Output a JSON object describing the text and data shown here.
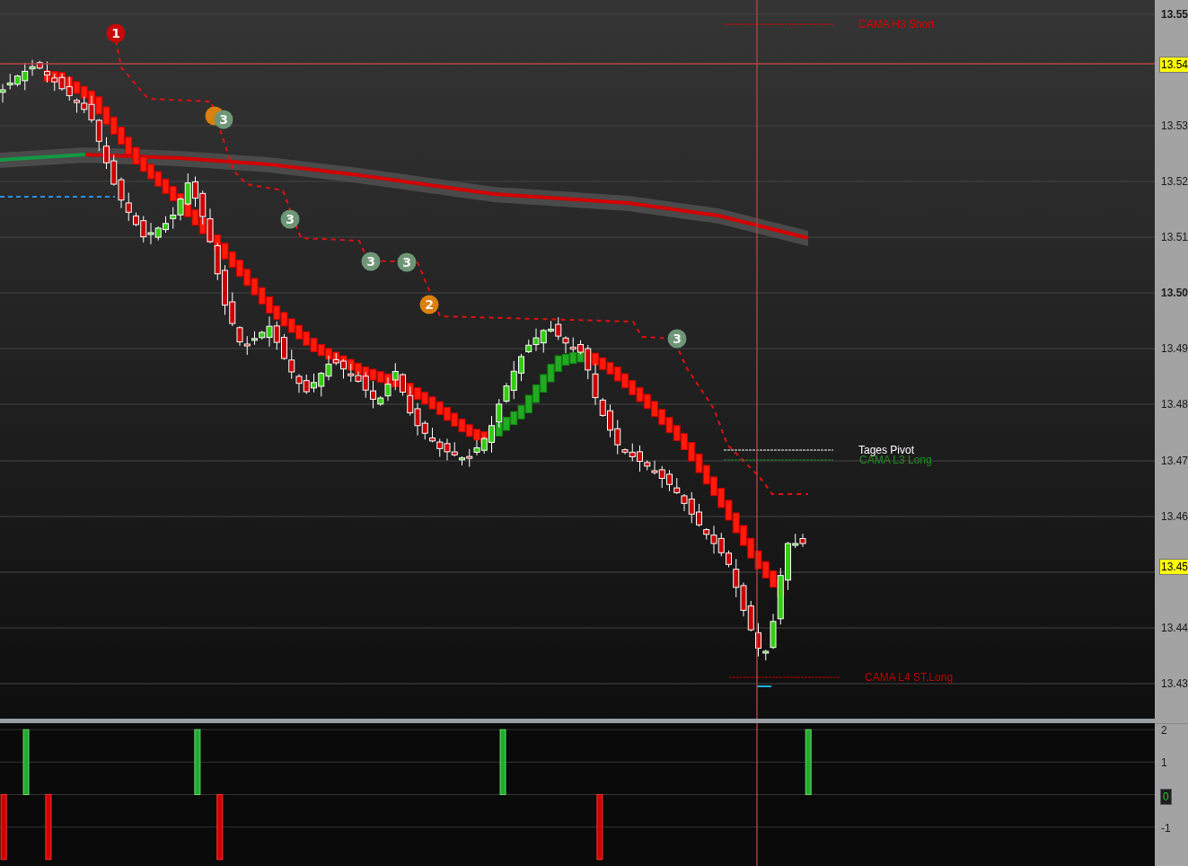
{
  "price_chart": {
    "signals": [
      {
        "label": "1",
        "color": "#c80a0a"
      },
      {
        "label": "3",
        "color": "#6e9676"
      },
      {
        "label": "3",
        "color": "#6e9676"
      },
      {
        "label": "3",
        "color": "#6e9676"
      },
      {
        "label": "3",
        "color": "#6e9676"
      },
      {
        "label": "2",
        "color": "#d9800f"
      },
      {
        "label": "3",
        "color": "#6e9676"
      }
    ],
    "levels": [
      {
        "label": "CAMA H3 Short",
        "color": "#e00000"
      },
      {
        "label": "Tages Pivot",
        "color": "#ffffff"
      },
      {
        "label": "CAMA L3 Long",
        "color": "#1f8f1f"
      },
      {
        "label": "CAMA L4 ST.Long",
        "color": "#c00000"
      }
    ]
  },
  "price_axis": {
    "ticks": [
      {
        "label": "13.55",
        "major": true
      },
      {
        "label": "13.53",
        "major": false
      },
      {
        "label": "13.52",
        "major": false
      },
      {
        "label": "13.51",
        "major": false
      },
      {
        "label": "13.50",
        "major": true
      },
      {
        "label": "13.49",
        "major": false
      },
      {
        "label": "13.48",
        "major": false
      },
      {
        "label": "13.47",
        "major": false
      },
      {
        "label": "13.46",
        "major": false
      },
      {
        "label": "13.44",
        "major": false
      },
      {
        "label": "13.43",
        "major": false
      }
    ],
    "markers": [
      {
        "label": "13.54"
      },
      {
        "label": "13.45"
      }
    ]
  },
  "indicator": {
    "chart_data": {
      "type": "bar",
      "yticks": [
        {
          "value": -1,
          "label": "-1"
        },
        {
          "value": 1,
          "label": "1"
        },
        {
          "value": 2,
          "label": "2"
        }
      ],
      "ylim": [
        -2.2,
        2.2
      ],
      "grid": true,
      "values": [
        -2,
        0,
        0,
        2,
        0,
        0,
        -2,
        0,
        0,
        0,
        0,
        0,
        0,
        0,
        0,
        0,
        0,
        0,
        0,
        0,
        0,
        0,
        0,
        0,
        0,
        0,
        2,
        0,
        0,
        -2,
        0,
        0,
        0,
        0,
        0,
        0,
        0,
        0,
        0,
        0,
        0,
        0,
        0,
        0,
        0,
        0,
        0,
        0,
        0,
        0,
        0,
        0,
        0,
        0,
        0,
        0,
        0,
        0,
        0,
        0,
        0,
        0,
        0,
        0,
        0,
        0,
        0,
        2,
        0,
        0,
        0,
        0,
        0,
        0,
        0,
        0,
        0,
        0,
        0,
        0,
        -2,
        0,
        0,
        0,
        0,
        0,
        0,
        0,
        0,
        0,
        0,
        0,
        0,
        0,
        0,
        0,
        0,
        0,
        0,
        0,
        0,
        0,
        0,
        0,
        0,
        0,
        0,
        0,
        2,
        0,
        0,
        0,
        0,
        0,
        0,
        0,
        0,
        0,
        0,
        0,
        0,
        0,
        0,
        0,
        0,
        0,
        0,
        0,
        0,
        0,
        0,
        0,
        0,
        0,
        0,
        0,
        0,
        0,
        0,
        0,
        0,
        0,
        0,
        0,
        0,
        0,
        0,
        0,
        0,
        0,
        0,
        0,
        0,
        0,
        0
      ]
    },
    "marker": {
      "label": "0"
    }
  }
}
